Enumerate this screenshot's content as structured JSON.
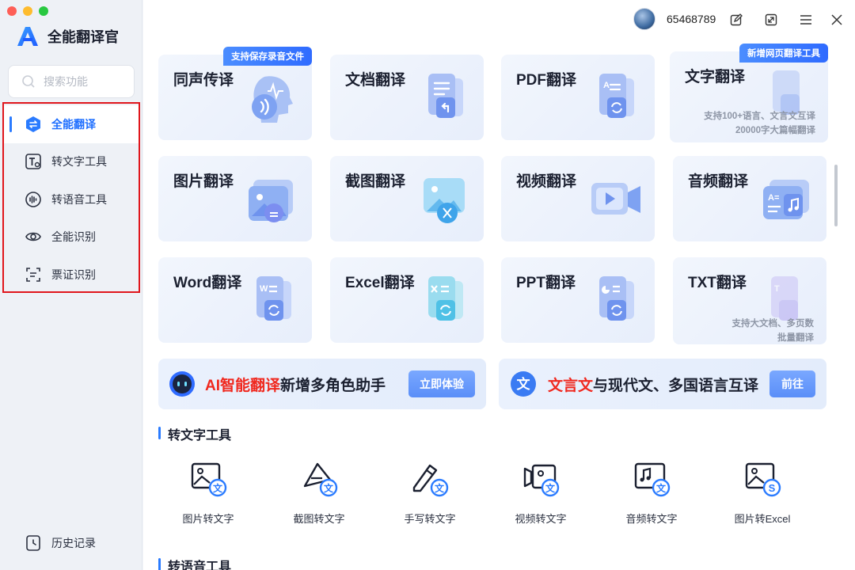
{
  "app": {
    "name": "全能翻译官"
  },
  "search": {
    "placeholder": "搜索功能"
  },
  "sidebar": {
    "items": [
      {
        "label": "全能翻译",
        "active": true,
        "icon": "translate-icon"
      },
      {
        "label": "转文字工具",
        "icon": "text-convert-icon"
      },
      {
        "label": "转语音工具",
        "icon": "voice-convert-icon"
      },
      {
        "label": "全能识别",
        "icon": "eye-icon"
      },
      {
        "label": "票证识别",
        "icon": "scan-icon"
      }
    ],
    "history": "历史记录"
  },
  "user": {
    "id": "65468789"
  },
  "cards": [
    {
      "title": "同声传译",
      "badge": "支持保存录音文件",
      "icon": "simultaneous-interpretation-icon"
    },
    {
      "title": "文档翻译",
      "icon": "document-icon"
    },
    {
      "title": "PDF翻译",
      "icon": "pdf-icon"
    },
    {
      "title": "文字翻译",
      "badge": "新增网页翻译工具",
      "desc1": "支持100+语言、文言文互译",
      "desc2": "20000字大篇幅翻译",
      "icon": "text-translate-icon"
    },
    {
      "title": "图片翻译",
      "icon": "image-icon"
    },
    {
      "title": "截图翻译",
      "icon": "screenshot-icon"
    },
    {
      "title": "视频翻译",
      "icon": "video-icon"
    },
    {
      "title": "音频翻译",
      "icon": "audio-icon"
    },
    {
      "title": "Word翻译",
      "icon": "word-icon"
    },
    {
      "title": "Excel翻译",
      "icon": "excel-icon"
    },
    {
      "title": "PPT翻译",
      "icon": "ppt-icon"
    },
    {
      "title": "TXT翻译",
      "desc1": "支持大文档、多页数",
      "desc2": "批量翻译",
      "icon": "txt-icon"
    }
  ],
  "banners": [
    {
      "highlight": "AI智能翻译",
      "text": "新增多角色助手",
      "button": "立即体验"
    },
    {
      "highlight": "文言文",
      "text": "与现代文、多国语言互译",
      "button": "前往"
    }
  ],
  "sections": {
    "text_tools": "转文字工具",
    "voice_tools": "转语音工具"
  },
  "text_tools": [
    {
      "label": "图片转文字",
      "icon": "image-to-text-icon"
    },
    {
      "label": "截图转文字",
      "icon": "screenshot-to-text-icon"
    },
    {
      "label": "手写转文字",
      "icon": "handwriting-to-text-icon"
    },
    {
      "label": "视频转文字",
      "icon": "video-to-text-icon"
    },
    {
      "label": "音频转文字",
      "icon": "audio-to-text-icon"
    },
    {
      "label": "图片转Excel",
      "icon": "image-to-excel-icon"
    }
  ],
  "colors": {
    "accent": "#2a7bff",
    "highlight": "#f0281e",
    "annotation_box": "#e0161c"
  }
}
